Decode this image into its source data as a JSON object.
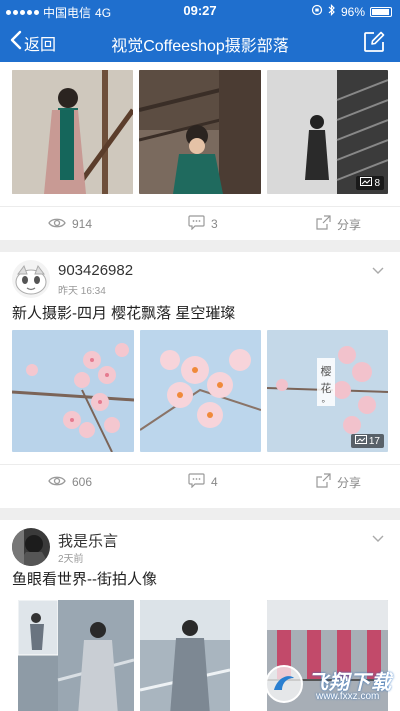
{
  "status_bar": {
    "carrier": "中国电信",
    "network": "4G",
    "time": "09:27",
    "battery": "96%"
  },
  "nav": {
    "back_label": "返回",
    "title": "视觉Coffeeshop摄影部落"
  },
  "colors": {
    "brand": "#1f6fce"
  },
  "posts": [
    {
      "photo_count_badge": "8",
      "views": "914",
      "comments": "3",
      "share_label": "分享"
    },
    {
      "username": "903426982",
      "time": "昨天 16:34",
      "title": "新人摄影-四月 樱花飘落 星空璀璨",
      "photo_count_badge": "17",
      "photo_text": "樱花。",
      "views": "606",
      "comments": "4",
      "share_label": "分享"
    },
    {
      "username": "我是乐言",
      "time": "2天前",
      "title": "鱼眼看世界--街拍人像"
    }
  ],
  "watermark": {
    "text": "飞翔下载",
    "url": "www.fxxz.com"
  }
}
